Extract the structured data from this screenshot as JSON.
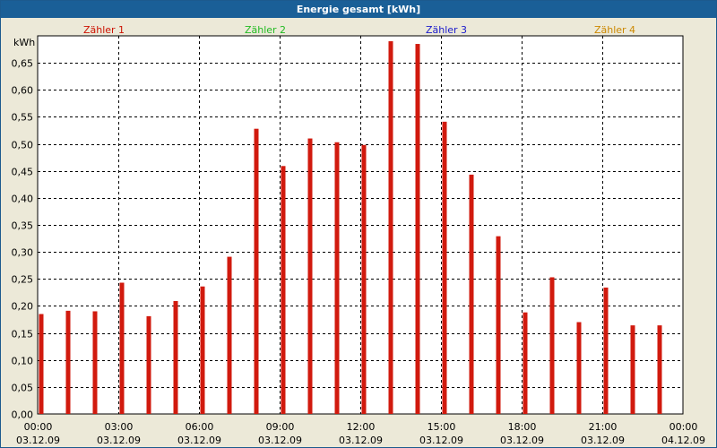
{
  "window": {
    "title": "Energie gesamt [kWh]"
  },
  "chart_data": {
    "type": "bar",
    "title": "Energie gesamt [kWh]",
    "ylabel": "kWh",
    "ylim": [
      0,
      0.7
    ],
    "y_ticks": [
      "0,00",
      "0,05",
      "0,10",
      "0,15",
      "0,20",
      "0,25",
      "0,30",
      "0,35",
      "0,40",
      "0,45",
      "0,50",
      "0,55",
      "0,60",
      "0,65"
    ],
    "x_ticks": [
      {
        "time": "00:00",
        "date": "03.12.09"
      },
      {
        "time": "03:00",
        "date": "03.12.09"
      },
      {
        "time": "06:00",
        "date": "03.12.09"
      },
      {
        "time": "09:00",
        "date": "03.12.09"
      },
      {
        "time": "12:00",
        "date": "03.12.09"
      },
      {
        "time": "15:00",
        "date": "03.12.09"
      },
      {
        "time": "18:00",
        "date": "03.12.09"
      },
      {
        "time": "21:00",
        "date": "03.12.09"
      },
      {
        "time": "00:00",
        "date": "04.12.09"
      }
    ],
    "x_range": [
      "03.12.09 00:00",
      "04.12.09 00:00"
    ],
    "grid": true,
    "legend": [
      {
        "name": "Zähler 1",
        "color": "#cc1100"
      },
      {
        "name": "Zähler 2",
        "color": "#22bb22"
      },
      {
        "name": "Zähler 3",
        "color": "#1a1acc"
      },
      {
        "name": "Zähler 4",
        "color": "#cc8800"
      }
    ],
    "series": [
      {
        "name": "Zähler 1",
        "color": "#d11a0e",
        "x": [
          "00:00",
          "01:00",
          "02:00",
          "03:00",
          "04:00",
          "05:00",
          "06:00",
          "07:00",
          "08:00",
          "09:00",
          "10:00",
          "11:00",
          "12:00",
          "13:00",
          "14:00",
          "15:00",
          "16:00",
          "17:00",
          "18:00",
          "19:00",
          "20:00",
          "21:00",
          "22:00",
          "23:00"
        ],
        "values": [
          0.185,
          0.191,
          0.19,
          0.243,
          0.181,
          0.209,
          0.236,
          0.291,
          0.528,
          0.459,
          0.51,
          0.503,
          0.498,
          0.69,
          0.685,
          0.541,
          0.443,
          0.329,
          0.188,
          0.253,
          0.17,
          0.234,
          0.164,
          0.164
        ]
      }
    ]
  }
}
